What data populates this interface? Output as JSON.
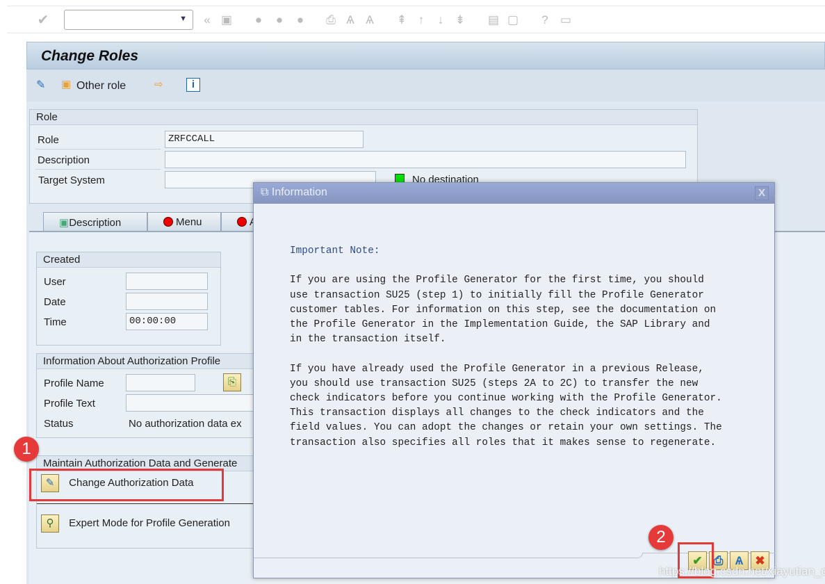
{
  "system_toolbar": {
    "command_field": "",
    "icons": [
      "enter-icon",
      "back-icon",
      "save-icon",
      "back-nav-icon",
      "exit-icon",
      "cancel-icon",
      "print-icon",
      "find-icon",
      "find-next-icon",
      "first-page-icon",
      "prev-page-icon",
      "next-page-icon",
      "last-page-icon",
      "new-session-icon",
      "shortcut-icon",
      "help-icon",
      "layout-icon"
    ]
  },
  "title": "Change Roles",
  "app_toolbar": {
    "other_role": "Other role"
  },
  "role_group": {
    "header": "Role",
    "role_label": "Role",
    "role_value": "ZRFCCALL",
    "description_label": "Description",
    "description_value": "",
    "target_label": "Target System",
    "target_value": "",
    "dest_status": "No destination",
    "dest_color": "#00e000"
  },
  "tabs": [
    {
      "label": "Description"
    },
    {
      "label": "Menu"
    },
    {
      "label": "A"
    }
  ],
  "created": {
    "header": "Created",
    "user_label": "User",
    "user_value": "",
    "date_label": "Date",
    "date_value": "",
    "time_label": "Time",
    "time_value": "00:00:00"
  },
  "auth_profile": {
    "header": "Information About Authorization Profile",
    "name_label": "Profile Name",
    "name_value": "",
    "text_label": "Profile Text",
    "text_value": "",
    "status_label": "Status",
    "status_value": "No authorization data ex"
  },
  "maintain": {
    "header": "Maintain Authorization Data and Generate",
    "change_btn": "Change Authorization Data",
    "expert_btn": "Expert Mode for Profile Generation"
  },
  "dialog": {
    "title": "Information",
    "heading": "Important Note:",
    "para1": "If you are using the Profile Generator for the first time, you should\nuse transaction SU25 (step 1) to initially fill the Profile Generator\ncustomer tables. For information on this step, see the documentation on\nthe Profile Generator in the Implementation Guide, the SAP Library and\nin the transaction itself.",
    "para2": "If you have already used the Profile Generator in a previous Release,\nyou should use transaction SU25 (steps 2A to 2C) to transfer the new\ncheck indicators before you continue working with the Profile Generator.\nThis transaction displays all changes to the check indicators and the\nfield values. You can adopt the changes or retain your own settings. The\ntransaction also specifies all roles that it makes sense to regenerate."
  },
  "annotations": {
    "step1": "1",
    "step2": "2"
  },
  "watermark": "https://blog.csdn.net/xiayutian_c"
}
